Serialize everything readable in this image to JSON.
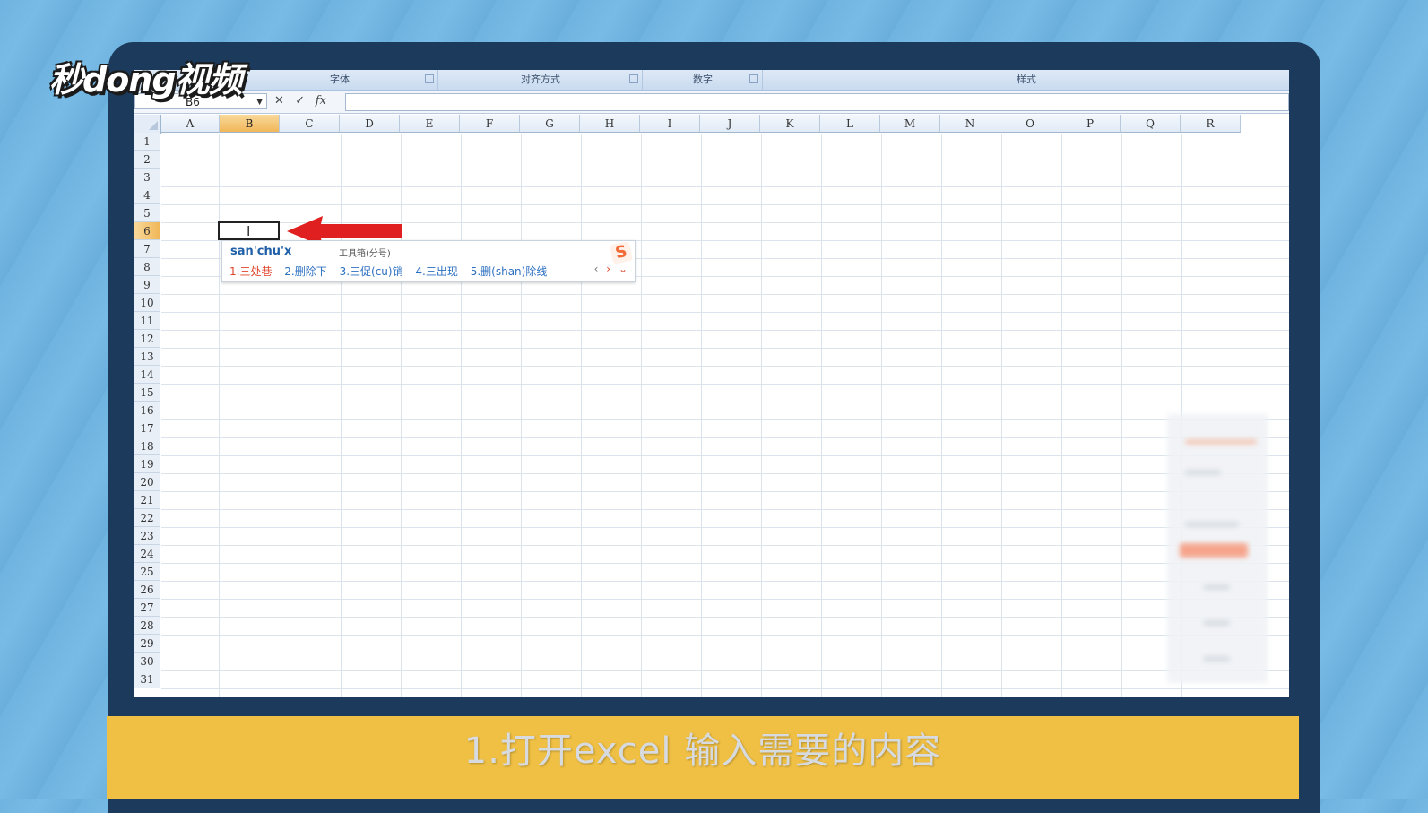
{
  "watermark": {
    "logo": "秒dong视频"
  },
  "ribbon": {
    "groups": [
      "字体",
      "对齐方式",
      "数字",
      "样式"
    ]
  },
  "formula_bar": {
    "name_box": "B6",
    "cancel_symbol": "✕",
    "enter_symbol": "✓",
    "fx_symbol": "fx",
    "content": ""
  },
  "sheet": {
    "columns": [
      "A",
      "B",
      "C",
      "D",
      "E",
      "F",
      "G",
      "H",
      "I",
      "J",
      "K",
      "L",
      "M",
      "N",
      "O",
      "P",
      "Q",
      "R"
    ],
    "rows": [
      "1",
      "2",
      "3",
      "4",
      "5",
      "6",
      "7",
      "8",
      "9",
      "10",
      "11",
      "12",
      "13",
      "14",
      "15",
      "16",
      "17",
      "18",
      "19",
      "20",
      "21",
      "22",
      "23",
      "24",
      "25",
      "26",
      "27",
      "28",
      "29",
      "30",
      "31"
    ],
    "selected_column": "B",
    "selected_row": "6"
  },
  "ime": {
    "composition": "san'chu'x",
    "toolbox_label": "工具箱(分号)",
    "logo": "S",
    "candidates": [
      "1.三处巷",
      "2.删除下",
      "3.三促(cu)销",
      "4.三出现",
      "5.删(shan)除线"
    ],
    "nav": [
      "‹",
      "›",
      "⌄"
    ]
  },
  "annotation": {
    "arrow_color": "#e02020"
  },
  "caption": {
    "text": "1.打开excel 输入需要的内容"
  },
  "colors": {
    "caption_bar": "#f0c044",
    "monitor": "#1c3a5c",
    "selected_header": "#f1b758"
  }
}
